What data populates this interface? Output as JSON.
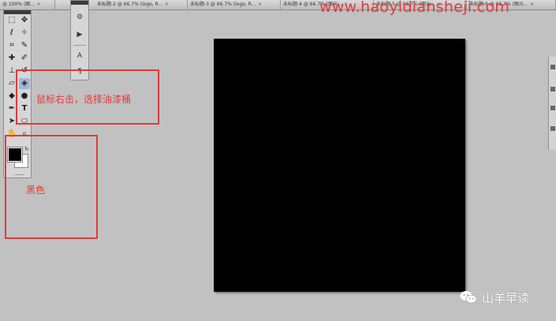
{
  "tabs": [
    {
      "label": "@ 100% (图…",
      "close": "×"
    },
    {
      "label": "未标题-2 @ 66.7% (logo, R…",
      "close": "×"
    },
    {
      "label": "未标题-3 @ 66.7% (logo, R…",
      "close": "×"
    },
    {
      "label": "未标题-4 @ 66.7% (图元…",
      "close": "×"
    },
    {
      "label": "未标题-5 @ 66.7% (图元…",
      "close": "×"
    },
    {
      "label": "未标题-6 @ 66.7% (图元…",
      "close": "×"
    }
  ],
  "watermark_url": "www.haoyidiansheji.com",
  "tools": {
    "tool_icons": [
      "marquee-icon",
      "move-icon",
      "lasso-icon",
      "magic-wand-icon",
      "crop-icon",
      "eyedropper-icon",
      "healing-icon",
      "brush-icon",
      "stamp-icon",
      "history-brush-icon",
      "eraser-icon",
      "paint-bucket-icon",
      "blur-icon",
      "dodge-icon",
      "pen-icon",
      "type-icon",
      "path-select-icon",
      "shape-icon",
      "hand-icon",
      "zoom-icon"
    ],
    "type_glyph": "T"
  },
  "annotations": {
    "tool_hint": "鼠标右击，选择油漆桶",
    "color_hint": "黑色"
  },
  "logo": {
    "label": "山羊早读"
  },
  "colors": {
    "annotation": "#e23a3a",
    "canvas": "#000000",
    "workspace": "#c1c1c1"
  }
}
